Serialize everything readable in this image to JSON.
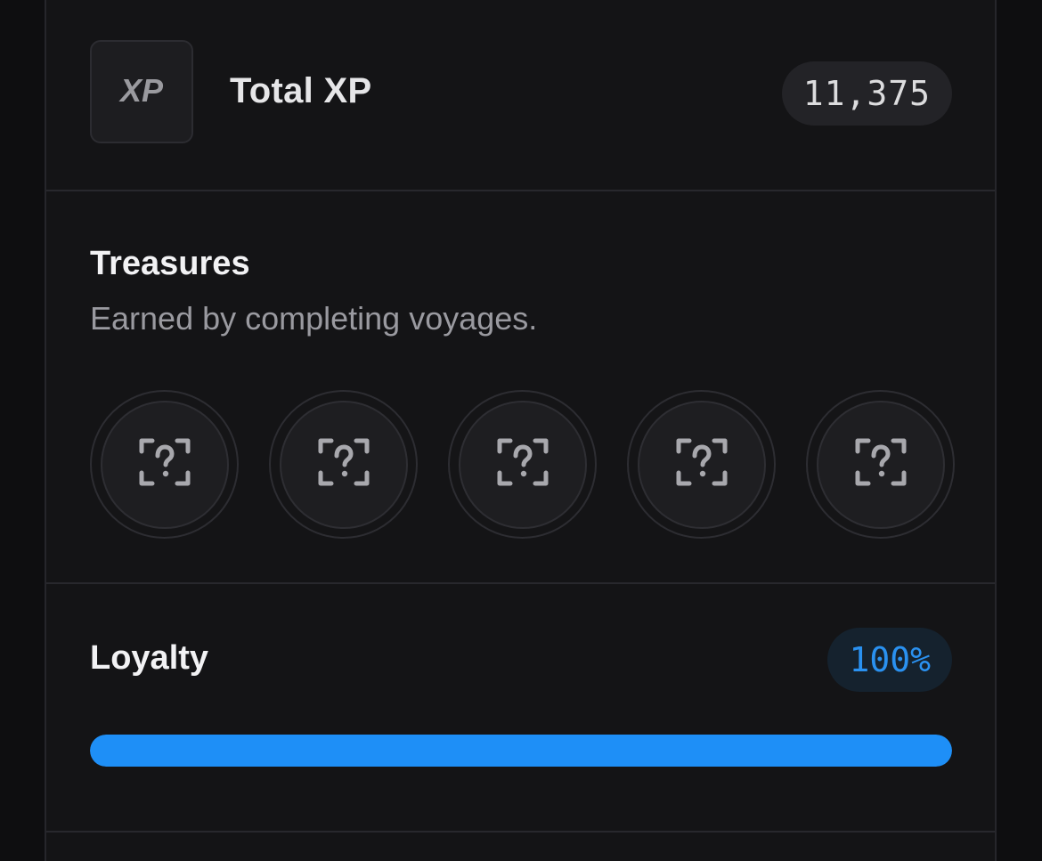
{
  "xp": {
    "badge_text": "XP",
    "title": "Total XP",
    "value": "11,375"
  },
  "treasures": {
    "title": "Treasures",
    "subtitle": "Earned by completing voyages.",
    "items": [
      {
        "icon": "unknown-treasure-icon",
        "state": "locked"
      },
      {
        "icon": "unknown-treasure-icon",
        "state": "locked"
      },
      {
        "icon": "unknown-treasure-icon",
        "state": "locked"
      },
      {
        "icon": "unknown-treasure-icon",
        "state": "locked"
      },
      {
        "icon": "unknown-treasure-icon",
        "state": "locked"
      }
    ]
  },
  "loyalty": {
    "title": "Loyalty",
    "value_label": "100%",
    "progress": 1.0
  },
  "colors": {
    "accent": "#1e8ff7",
    "background": "#141416",
    "text_primary": "#f2f2f4",
    "text_secondary": "#9a9aa0"
  }
}
